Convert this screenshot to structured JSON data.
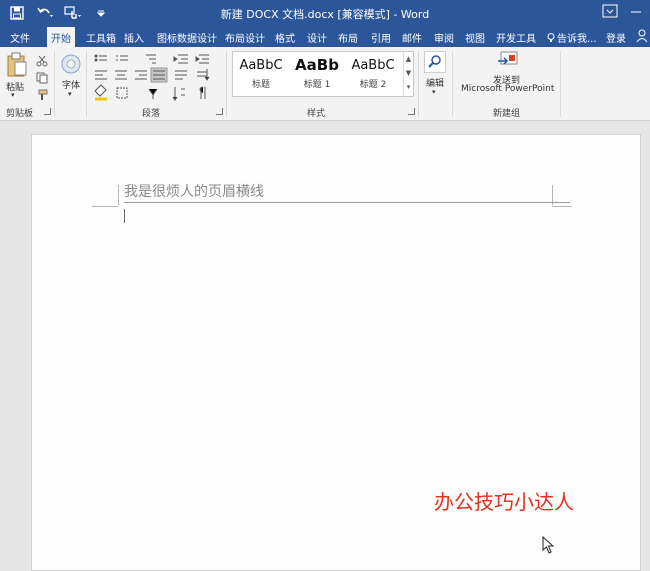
{
  "titlebar": {
    "title": "新建 DOCX 文档.docx [兼容模式] - Word",
    "qat_icons": [
      "save-icon",
      "undo-icon",
      "touch-mode-icon",
      "customize-qat-icon"
    ],
    "window_icons": [
      "ribbon-display-options-icon",
      "minimize-icon",
      "maximize-icon",
      "close-icon"
    ]
  },
  "tabs": {
    "file": "文件",
    "home": "开始",
    "toolbox": "工具箱",
    "insert": "插入",
    "chart_design": "图标数据设计",
    "layout_design": "布局设计",
    "format": "格式",
    "design": "设计",
    "layout": "布局",
    "references": "引用",
    "mailings": "邮件",
    "review": "审阅",
    "view": "视图",
    "developer": "开发工具",
    "tell_me": "告诉我...",
    "signin": "登录"
  },
  "ribbon": {
    "clipboard": {
      "label": "剪贴板",
      "paste": "粘贴"
    },
    "font": {
      "label": "字体"
    },
    "paragraph": {
      "label": "段落"
    },
    "styles": {
      "label": "样式",
      "items": [
        {
          "sample": "AaBbC",
          "name": "标题"
        },
        {
          "sample": "AaBb",
          "name": "标题 1"
        },
        {
          "sample": "AaBbC",
          "name": "标题 2"
        }
      ]
    },
    "editing": {
      "label": "编辑"
    },
    "newgroup": {
      "label": "新建组",
      "send_line1": "发送到",
      "send_line2": "Microsoft PowerPoint"
    }
  },
  "document": {
    "header_text": "我是很烦人的页眉横线"
  },
  "watermark": "办公技巧小达人",
  "colors": {
    "title_bar": "#2b579a",
    "ribbon_bg": "#f3f3f3",
    "watermark": "#e3331f"
  }
}
